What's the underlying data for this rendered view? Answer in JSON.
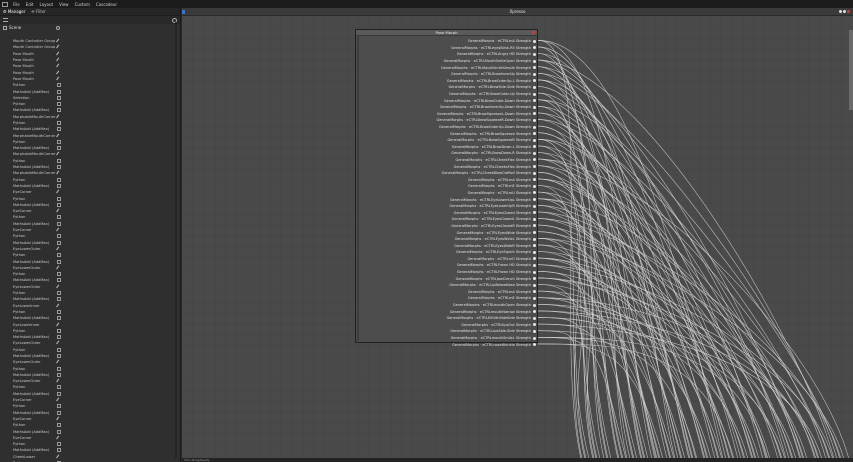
{
  "menubar": {
    "items": [
      "File",
      "Edit",
      "Layout",
      "View",
      "Custom",
      "Cascadeur"
    ]
  },
  "left_panel": {
    "tabs": [
      "⚙ Manager",
      "✣ Filter"
    ],
    "root_label": "Scene",
    "rows": [
      {
        "label": "Mouth Controller Group",
        "icon": "pin"
      },
      {
        "label": "Mouth Controller Group",
        "icon": "pin"
      },
      {
        "label": "Pose Mouth",
        "icon": "pin"
      },
      {
        "label": "Pose Mouth",
        "icon": "pin"
      },
      {
        "label": "Pose Mouth",
        "icon": "pin"
      },
      {
        "label": "Pose Mouth",
        "icon": "pin"
      },
      {
        "label": "Pose Mouth",
        "icon": "pin"
      },
      {
        "label": "Python",
        "icon": "box"
      },
      {
        "label": "MathsAdd (AddMax)",
        "icon": "box"
      },
      {
        "label": "Selection",
        "icon": "box"
      },
      {
        "label": "Python",
        "icon": "box"
      },
      {
        "label": "MathsAdd (AddMax)",
        "icon": "box"
      },
      {
        "label": "MorphableMouthCorner",
        "icon": "pin"
      },
      {
        "label": "Python",
        "icon": "box"
      },
      {
        "label": "MathsAdd (AddMax)",
        "icon": "box"
      },
      {
        "label": "MorphableMouthCorner",
        "icon": "pin"
      },
      {
        "label": "Python",
        "icon": "box"
      },
      {
        "label": "MathsAdd (AddMax)",
        "icon": "box"
      },
      {
        "label": "MorphableMouthCorner",
        "icon": "pin"
      },
      {
        "label": "Python",
        "icon": "box"
      },
      {
        "label": "MathsAdd (AddMax)",
        "icon": "box"
      },
      {
        "label": "MorphableMouthCorner",
        "icon": "pin"
      },
      {
        "label": "Python",
        "icon": "box"
      },
      {
        "label": "MathsAdd (AddMax)",
        "icon": "box"
      },
      {
        "label": "EyeCorner",
        "icon": "pin"
      },
      {
        "label": "Python",
        "icon": "box"
      },
      {
        "label": "MathsAdd (AddMax)",
        "icon": "box"
      },
      {
        "label": "EyeCorner",
        "icon": "pin"
      },
      {
        "label": "Python",
        "icon": "box"
      },
      {
        "label": "MathsAdd (AddMax)",
        "icon": "box"
      },
      {
        "label": "EyeCorner",
        "icon": "pin"
      },
      {
        "label": "Python",
        "icon": "box"
      },
      {
        "label": "MathsAdd (AddMax)",
        "icon": "box"
      },
      {
        "label": "EyeLowerOuter",
        "icon": "pin"
      },
      {
        "label": "Python",
        "icon": "box"
      },
      {
        "label": "MathsAdd (AddMax)",
        "icon": "box"
      },
      {
        "label": "EyeLowerOuter",
        "icon": "pin"
      },
      {
        "label": "Python",
        "icon": "box"
      },
      {
        "label": "MathsAdd (AddMax)",
        "icon": "box"
      },
      {
        "label": "EyeLowerOuter",
        "icon": "pin"
      },
      {
        "label": "Python",
        "icon": "box"
      },
      {
        "label": "MathsAdd (AddMax)",
        "icon": "box"
      },
      {
        "label": "EyeLowerInner",
        "icon": "pin"
      },
      {
        "label": "Python",
        "icon": "box"
      },
      {
        "label": "MathsAdd (AddMax)",
        "icon": "box"
      },
      {
        "label": "EyeLowerInner",
        "icon": "pin"
      },
      {
        "label": "Python",
        "icon": "box"
      },
      {
        "label": "MathsAdd (AddMax)",
        "icon": "box"
      },
      {
        "label": "EyeLowerOuter",
        "icon": "pin"
      },
      {
        "label": "Python",
        "icon": "box"
      },
      {
        "label": "MathsAdd (AddMax)",
        "icon": "box"
      },
      {
        "label": "EyeLowerOuter",
        "icon": "pin"
      },
      {
        "label": "Python",
        "icon": "box"
      },
      {
        "label": "MathsAdd (AddMax)",
        "icon": "box"
      },
      {
        "label": "EyeLowerOuter",
        "icon": "pin"
      },
      {
        "label": "Python",
        "icon": "box"
      },
      {
        "label": "MathsAdd (AddMax)",
        "icon": "box"
      },
      {
        "label": "EyeCorner",
        "icon": "pin"
      },
      {
        "label": "Python",
        "icon": "box"
      },
      {
        "label": "MathsAdd (AddMax)",
        "icon": "box"
      },
      {
        "label": "EyeCorner",
        "icon": "pin"
      },
      {
        "label": "Python",
        "icon": "box"
      },
      {
        "label": "MathsAdd (AddMax)",
        "icon": "box"
      },
      {
        "label": "EyeCorner",
        "icon": "pin"
      },
      {
        "label": "Python",
        "icon": "box"
      },
      {
        "label": "MathsAdd (AddMax)",
        "icon": "box"
      },
      {
        "label": "CheekLower",
        "icon": "pin"
      },
      {
        "label": "Python",
        "icon": "box"
      }
    ]
  },
  "viewport": {
    "title": "Xpresso",
    "status_text": "Ctrl+Drag/Ready"
  },
  "node": {
    "title": "Pose Morph",
    "ports": [
      "GeneralMorphs · eCTRLmA Strength",
      "GeneralMorphs · eCTRLeyesBlink-R5 Strength",
      "GeneralMorphs · eCTRLAngry HD Strength",
      "GeneralMorphs · eCTRLMouthSmileOpen Strength",
      "GeneralMorphs · eCTRLMouthSmileSimple Strength",
      "GeneralMorphs · eCTRLBrowInnerUp Strength",
      "GeneralMorphs · eCTRLBrowOuterUp-L Strength",
      "GeneralMorphs · eCTRLBrowSide-Side Strength",
      "GeneralMorphs · eCTRLBrowOuter-Up Strength",
      "GeneralMorphs · eCTRLBrowOuter-Down Strength",
      "GeneralMorphs · eCTRLBrowInnerUp-Down Strength",
      "GeneralMorphs · eCTRLBrowSqueezeL-Down Strength",
      "GeneralMorphs · eCTRLBrowSqueezeR-Down Strength",
      "GeneralMorphs · eCTRLBrowOuterUp-Down Strength",
      "GeneralMorphs · eCTRLBrowSqueeze Strength",
      "GeneralMorphs · eCTRLBrowSqueezeR Strength",
      "GeneralMorphs · eCTRLBrowDown-L Strength",
      "GeneralMorphs · eCTRLBrowDown-R Strength",
      "GeneralMorphs · eCTRLCheekFlex Strength",
      "GeneralMorphs · eCTRLCheeksFlex Strength",
      "GeneralMorphs · eCTRLCheekBlowOutRoll Strength",
      "GeneralMorphs · eCTRLmA Strength",
      "GeneralMorphs · eCTRLmE Strength",
      "GeneralMorphs · eCTRLmU Strength",
      "GeneralMorphs · eCTRLEyeLowerUpL Strength",
      "GeneralMorphs · eCTRLEyeLowerUpR Strength",
      "GeneralMorphs · eCTRLEyesClosed Strength",
      "GeneralMorphs · eCTRLEyesClosedL Strength",
      "GeneralMorphs · eCTRLEyesClosedR Strength",
      "GeneralMorphs · eCTRLEyesWide Strength",
      "GeneralMorphs · eCTRLEyesWideL Strength",
      "GeneralMorphs · eCTRLEyesWideR Strength",
      "GeneralMorphs · eCTRLEyeSquint Strength",
      "GeneralMorphs · eCTRLmO Strength",
      "GeneralMorphs · eCTRLFrown HD Strength",
      "GeneralMorphs · eCTRLFrown HD Strength",
      "GeneralMorphs · eCTRLJawClench Strength",
      "GeneralMorphs · eCTRLLipBelowNose Strength",
      "GeneralMorphs · eCTRLmA Strength",
      "GeneralMorphs · eCTRLmE Strength",
      "GeneralMorphs · eCTRLmouthOpen Strength",
      "GeneralMorphs · eCTRLmouthNarrow Strength",
      "GeneralMorphs · eCTRLMOUthSideSide Strength",
      "GeneralMorphs · eCTRLlipsOut Strength",
      "GeneralMorphs · eCTRLLipsSide-Side Strength",
      "GeneralMorphs · eCTRLmouthSmileL Strength",
      "GeneralMorphs · eCTRLnoseWrinkle Strength"
    ]
  }
}
